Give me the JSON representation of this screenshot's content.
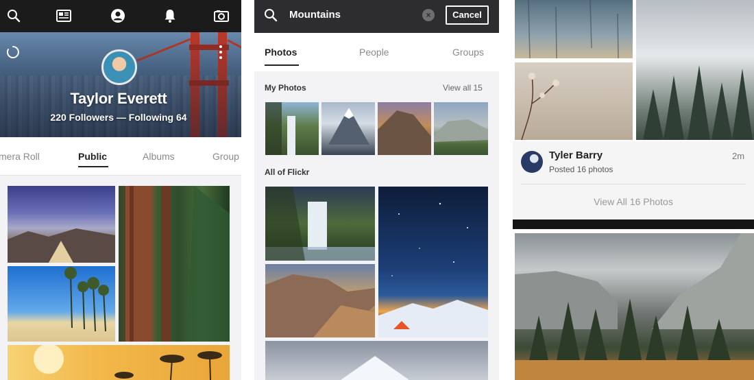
{
  "colors": {
    "topbar": "#1b1b1c",
    "searchbar": "#2d2d2f",
    "active_text": "#222222",
    "inactive_text": "#8a8a8a",
    "bridge_red": "#c23a2a"
  },
  "profile_screen": {
    "topbar_icons": [
      "search-icon",
      "feed-icon",
      "profile-icon",
      "notifications-icon",
      "camera-icon"
    ],
    "name": "Taylor Everett",
    "stats": "220 Followers — Following 64",
    "tabs": [
      {
        "label": "Camera Roll",
        "visible_text": "mera Roll"
      },
      {
        "label": "Public",
        "active": true
      },
      {
        "label": "Albums"
      },
      {
        "label": "Groups",
        "visible_text": "Group"
      }
    ]
  },
  "search_screen": {
    "query": "Mountains",
    "cancel_label": "Cancel",
    "tabs": [
      {
        "label": "Photos",
        "active": true
      },
      {
        "label": "People"
      },
      {
        "label": "Groups"
      }
    ],
    "my_photos": {
      "title": "My Photos",
      "view_all": "View all 15"
    },
    "all_of_flickr": {
      "title": "All of Flickr"
    }
  },
  "feed_screen": {
    "activity": {
      "name": "Tyler Barry",
      "subtitle": "Posted 16 photos",
      "time": "2m",
      "view_all": "View All 16 Photos"
    }
  }
}
